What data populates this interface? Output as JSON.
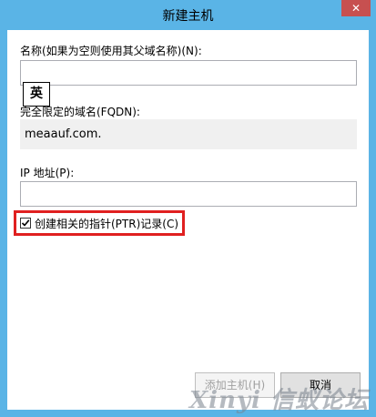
{
  "window": {
    "title": "新建主机",
    "close_label": "✕"
  },
  "form": {
    "name_label": "名称(如果为空则使用其父域名称)(N):",
    "name_value": "",
    "fqdn_label": "完全限定的域名(FQDN):",
    "fqdn_value": "meaauf.com.",
    "ip_label": "IP 地址(P):",
    "ip_value": "",
    "ptr_checkbox_label": "创建相关的指针(PTR)记录(C)",
    "ptr_checked": true
  },
  "ime": {
    "indicator": "英"
  },
  "buttons": {
    "add_host": "添加主机(H)",
    "cancel": "取消"
  },
  "watermark": {
    "text": "Xinyi 信蚁论坛"
  },
  "colors": {
    "frame": "#5ab4e6",
    "highlight": "#e02020"
  }
}
